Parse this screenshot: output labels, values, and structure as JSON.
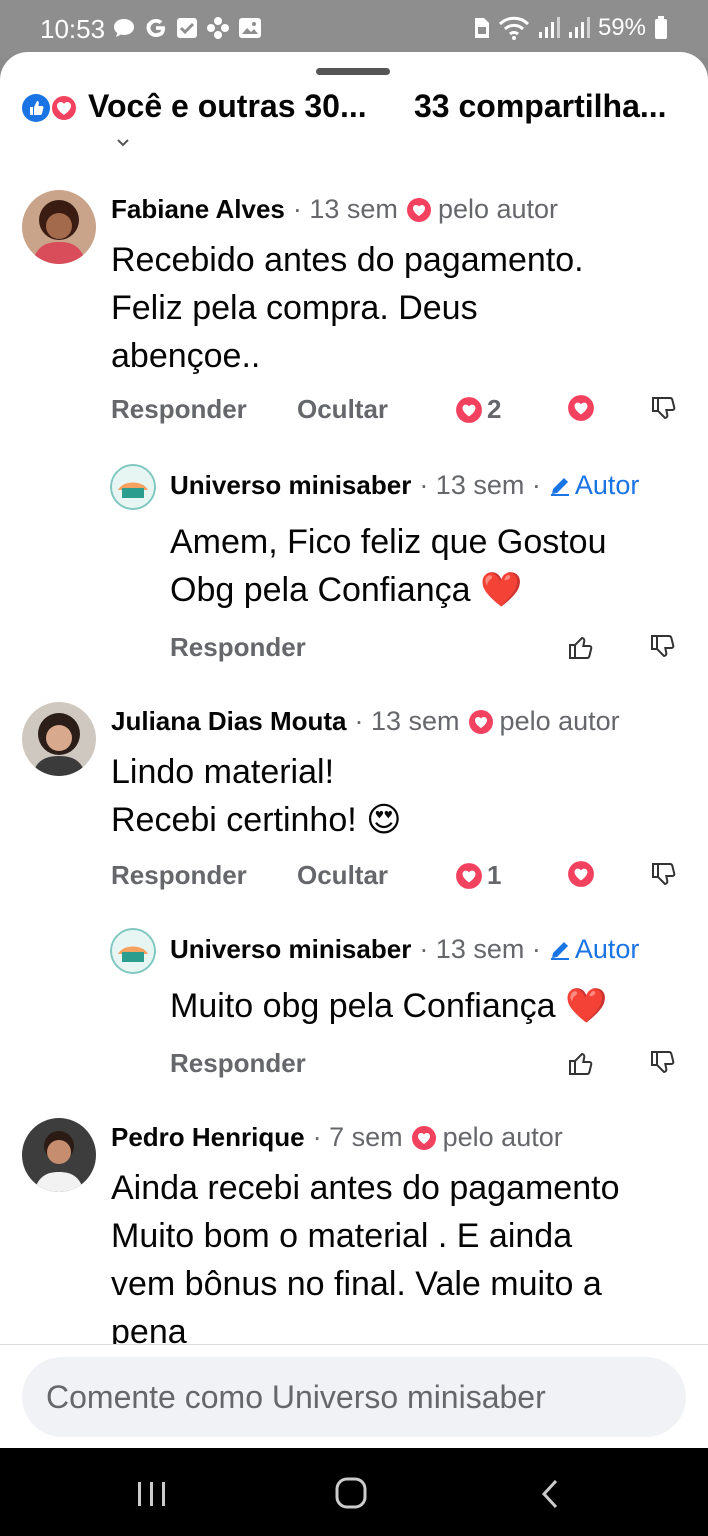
{
  "status": {
    "time": "10:53",
    "left_icons": [
      "chat-bubble-icon",
      "google-icon",
      "check-box-icon",
      "flower-icon",
      "image-icon"
    ],
    "battery": "59%"
  },
  "summary": {
    "reactions_text": "Você e outras 30...",
    "shares_text": "33 compartilha..."
  },
  "comments": [
    {
      "name": "Fabiane Alves",
      "time": "· 13 sem",
      "badge": "pelo autor",
      "lines": [
        "Recebido antes do pagamento.",
        "Feliz pela compra. Deus",
        "abençoe.."
      ],
      "reply_label": "Responder",
      "hide_label": "Ocultar",
      "reaction_count": "2"
    },
    {
      "name": "Universo minisaber",
      "time": "· 13 sem ·",
      "badge": "Autor",
      "lines": [
        "Amem, Fico feliz que Gostou",
        "Obg pela Confiança ❤️"
      ],
      "reply_label": "Responder"
    },
    {
      "name": "Juliana Dias Mouta",
      "time": "· 13 sem",
      "badge": "pelo autor",
      "lines": [
        "Lindo material!",
        "Recebi certinho! 😍"
      ],
      "reply_label": "Responder",
      "hide_label": "Ocultar",
      "reaction_count": "1"
    },
    {
      "name": "Universo minisaber",
      "time": "· 13 sem ·",
      "badge": "Autor",
      "lines": [
        "Muito obg pela Confiança ❤️"
      ],
      "reply_label": "Responder"
    },
    {
      "name": "Pedro Henrique",
      "time": "· 7 sem",
      "badge": "pelo autor",
      "lines": [
        "Ainda recebi antes do pagamento",
        "Muito bom o material . E ainda",
        "vem bônus no final. Vale muito a",
        "pena"
      ]
    }
  ],
  "input": {
    "placeholder": "Comente como Universo minisaber"
  },
  "colors": {
    "accent": "#1b74e4",
    "love": "#f3425f",
    "muted": "#65676b"
  }
}
